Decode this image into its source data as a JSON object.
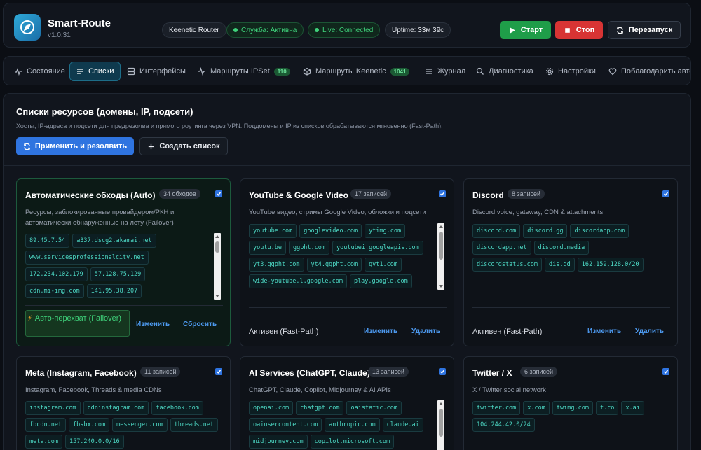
{
  "header": {
    "title": "Smart-Route",
    "version": "v1.0.31",
    "router_label": "Keenetic Router",
    "service_status": "Служба: Активна",
    "live_status": "Live: Connected",
    "uptime": "Uptime: 33м 39с",
    "start_label": "Старт",
    "stop_label": "Стоп",
    "restart_label": "Перезапуск"
  },
  "nav": {
    "items": [
      {
        "label": "Состояние",
        "icon": "activity-icon"
      },
      {
        "label": "Списки",
        "icon": "list-icon"
      },
      {
        "label": "Интерфейсы",
        "icon": "server-icon"
      },
      {
        "label": "Маршруты IPSet",
        "icon": "pulse-icon",
        "badge": "110"
      },
      {
        "label": "Маршруты Keenetic",
        "icon": "package-icon",
        "badge": "1041"
      },
      {
        "label": "Журнал",
        "icon": "log-icon"
      },
      {
        "label": "Диагностика",
        "icon": "search-icon"
      },
      {
        "label": "Настройки",
        "icon": "gear-icon"
      },
      {
        "label": "Поблагодарить автор",
        "icon": "heart-icon"
      }
    ]
  },
  "lists": {
    "title": "Списки ресурсов (домены, IP, подсети)",
    "description": "Хосты, IP-адреса и подсети для предрезолва и прямого роутинга через VPN. Поддомены и IP из списков обрабатываются мгновенно (Fast-Path).",
    "apply_label": "Применить и резолвить",
    "create_label": "Создать список"
  },
  "cards": [
    {
      "title": "Автоматические обходы (Auto)",
      "count": "34 обходов",
      "desc_line1": "Ресурсы, заблокированные провайдером/РКН и",
      "desc_line2": "автоматически обнаруженные на лету (Failover)",
      "chips": [
        "89.45.7.54",
        "a337.dscg2.akamai.net",
        "www.servicesprofessionalcity.net",
        "172.234.102.179",
        "57.128.75.129",
        "cdn.mi-img.com",
        "141.95.38.207"
      ],
      "failover_label": "Авто-перехват (Failover)",
      "edit_label": "Изменить",
      "reset_label": "Сбросить"
    },
    {
      "title": "YouTube & Google Video",
      "count": "17 записей",
      "desc_line1": "YouTube видео, стримы Google Video, обложки и подсети",
      "chips": [
        "youtube.com",
        "googlevideo.com",
        "ytimg.com",
        "youtu.be",
        "ggpht.com",
        "youtubei.googleapis.com",
        "yt3.ggpht.com",
        "yt4.ggpht.com",
        "gvt1.com",
        "wide-youtube.l.google.com",
        "play.google.com"
      ],
      "status": "Активен (Fast-Path)",
      "edit_label": "Изменить",
      "delete_label": "Удалить"
    },
    {
      "title": "Discord",
      "count": "8 записей",
      "desc_line1": "Discord voice, gateway, CDN & attachments",
      "chips": [
        "discord.com",
        "discord.gg",
        "discordapp.com",
        "discordapp.net",
        "discord.media",
        "discordstatus.com",
        "dis.gd",
        "162.159.128.0/20"
      ],
      "status": "Активен (Fast-Path)",
      "edit_label": "Изменить",
      "delete_label": "Удалить"
    },
    {
      "title": "Meta (Instagram, Facebook)",
      "count": "11 записей",
      "desc_line1": "Instagram, Facebook, Threads & media CDNs",
      "chips": [
        "instagram.com",
        "cdninstagram.com",
        "facebook.com",
        "fbcdn.net",
        "fbsbx.com",
        "messenger.com",
        "threads.net",
        "meta.com",
        "157.240.0.0/16"
      ]
    },
    {
      "title": "AI Services (ChatGPT, Claude)",
      "count": "13 записей",
      "desc_line1": "ChatGPT, Claude, Copilot, Midjourney & AI APIs",
      "chips": [
        "openai.com",
        "chatgpt.com",
        "oaistatic.com",
        "oaiusercontent.com",
        "anthropic.com",
        "claude.ai",
        "midjourney.com",
        "copilot.microsoft.com"
      ]
    },
    {
      "title": "Twitter / X",
      "count": "6 записей",
      "desc_line1": "X / Twitter social network",
      "chips": [
        "twitter.com",
        "x.com",
        "twimg.com",
        "t.co",
        "x.ai",
        "104.244.42.0/24"
      ]
    }
  ],
  "colors": {
    "accent_blue": "#2f74e0",
    "start_green": "#1f9d49",
    "stop_red": "#d83434",
    "chip_text": "#4dd9c5"
  }
}
